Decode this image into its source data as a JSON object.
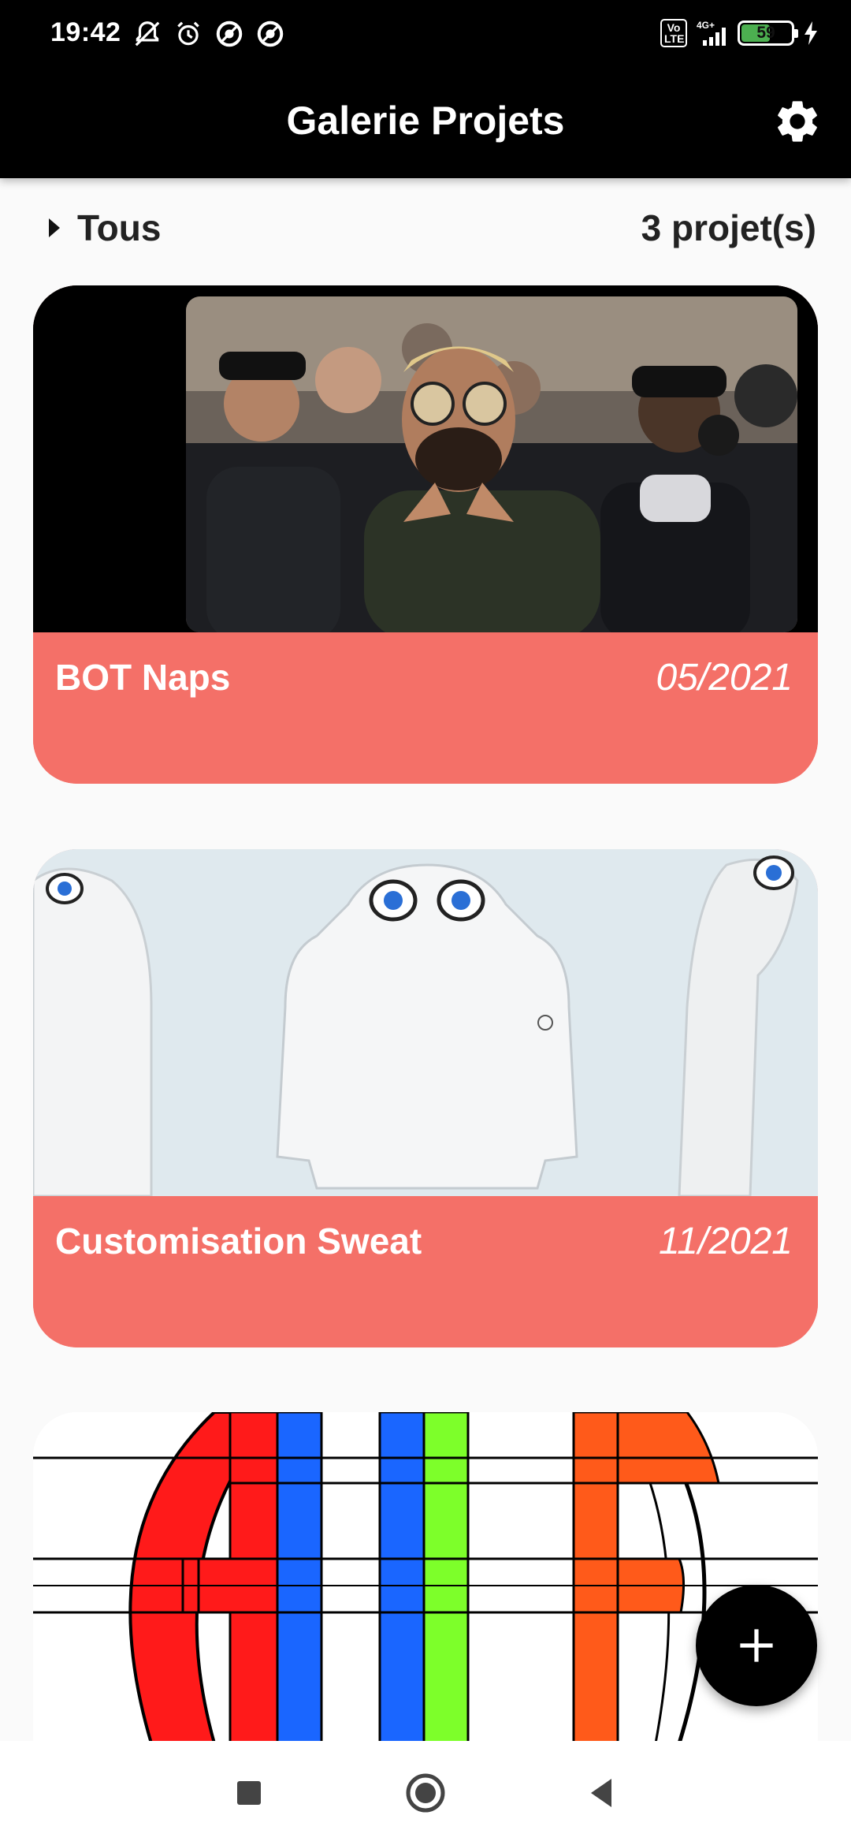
{
  "status_bar": {
    "time": "19:42",
    "battery_level": "59",
    "network": "4G+",
    "volte": "Vo LTE",
    "icons": [
      "notifications-off-icon",
      "alarm-icon",
      "app-notification-icon",
      "app-notification-icon",
      "signal-icon",
      "battery-icon",
      "charging-icon"
    ]
  },
  "app_bar": {
    "title": "Galerie Projets",
    "settings_icon": "gear-icon"
  },
  "filter": {
    "label": "Tous",
    "count_text": "3 projet(s)"
  },
  "projects": [
    {
      "title": "BOT Naps",
      "date": "05/2021",
      "image": "music-video-group-photo"
    },
    {
      "title": "Customisation Sweat",
      "date": "11/2021",
      "image": "white-hoodie-with-eye-embroidery"
    },
    {
      "title": "",
      "date": "",
      "image": "colorful-geometric-logo-construction"
    }
  ],
  "fab": {
    "icon": "plus-icon"
  },
  "nav_bar": {
    "icons": [
      "recents-icon",
      "home-icon",
      "back-icon"
    ]
  },
  "colors": {
    "app_bar": "#000000",
    "card_accent": "#f47068",
    "background": "#fafafa",
    "fab": "#000000"
  }
}
